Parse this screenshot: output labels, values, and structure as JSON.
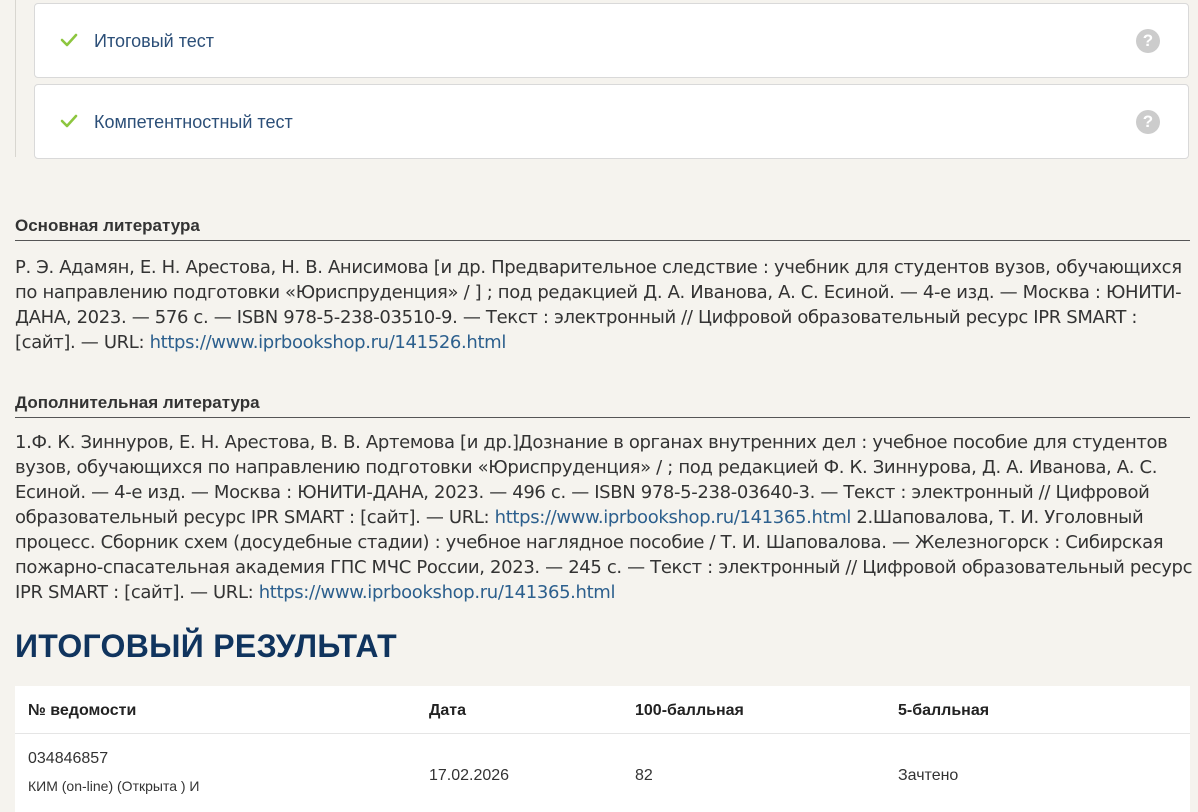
{
  "tests": [
    {
      "title": "Итоговый тест",
      "status_icon": "check-icon",
      "help_icon": "question-icon",
      "help_symbol": "?"
    },
    {
      "title": "Компетентностный тест",
      "status_icon": "check-icon",
      "help_icon": "question-icon",
      "help_symbol": "?"
    }
  ],
  "colors": {
    "check": "#8dc63f",
    "link": "#2c5f8d",
    "title": "#10345e",
    "background": "#f5f3ee"
  },
  "main_literature": {
    "heading": "Основная литература",
    "text": "Р. Э. Адамян, Е. Н. Арестова, Н. В. Анисимова [и др. Предварительное следствие : учебник для студентов вузов, обучающихся по направлению подготовки «Юриспруденция» / ] ; под редакцией Д. А. Иванова, А. С. Есиной. — 4-е изд. — Москва : ЮНИТИ-ДАНА, 2023. — 576 с. — ISBN 978-5-238-03510-9. — Текст : электронный // Цифровой образовательный ресурс IPR SMART : [сайт]. — URL: ",
    "link": "https://www.iprbookshop.ru/141526.html"
  },
  "additional_literature": {
    "heading": "Дополнительная литература",
    "text1": "1.Ф. К. Зиннуров, Е. Н. Арестова, В. В. Артемова [и др.]Дознание в органах внутренних дел : учебное пособие для студентов вузов, обучающихся по направлению подготовки «Юриспруденция» / ; под редакцией Ф. К. Зиннурова, Д. А. Иванова, А. С. Есиной. — 4-е изд. — Москва : ЮНИТИ-ДАНА, 2023. — 496 с. — ISBN 978-5-238-03640-3. — Текст : электронный // Цифровой образовательный ресурс IPR SMART : [сайт]. — URL: ",
    "link1": "https://www.iprbookshop.ru/141365.html",
    "text2": " 2.Шаповалова, Т. И. Уголовный процесс. Сборник схем (досудебные стадии) : учебное наглядное пособие / Т. И. Шаповалова. — Железногорск : Сибирская пожарно-спасательная академия ГПС МЧС России, 2023. — 245 с. — Текст : электронный // Цифровой образовательный ресурс IPR SMART : [сайт]. — URL: ",
    "link2": "https://www.iprbookshop.ru/141365.html"
  },
  "result": {
    "title": "ИТОГОВЫЙ РЕЗУЛЬТАТ",
    "columns": [
      "№ ведомости",
      "Дата",
      "100-балльная",
      "5-балльная"
    ],
    "rows": [
      {
        "number": "034846857",
        "description": "КИМ (on-line) (Открыта ) И",
        "date": "17.02.2026",
        "score100": "82",
        "score5": "Зачтено"
      }
    ]
  }
}
